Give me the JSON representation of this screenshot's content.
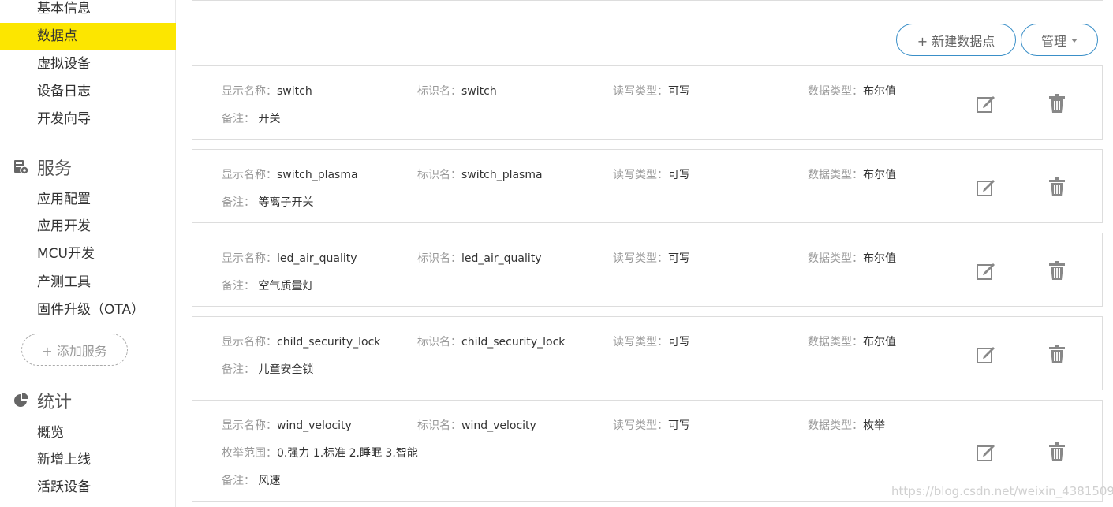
{
  "sidebar": {
    "items_top": [
      "基本信息",
      "数据点",
      "虚拟设备",
      "设备日志",
      "开发向导"
    ],
    "active": "数据点",
    "service_section": "服务",
    "service_items": [
      "应用配置",
      "应用开发",
      "MCU开发",
      "产测工具",
      "固件升级（OTA）"
    ],
    "add_service": "+ 添加服务",
    "stats_section": "统计",
    "stats_items": [
      "概览",
      "新增上线",
      "活跃设备"
    ]
  },
  "toolbar": {
    "new_label": "+ 新建数据点",
    "manage_label": "管理"
  },
  "labels": {
    "display_name": "显示名称：",
    "identifier": "标识名：",
    "rw_type": "读写类型：",
    "data_type": "数据类型：",
    "note": "备注：",
    "enum_range": "枚举范围："
  },
  "datapoints": [
    {
      "display_name": "switch",
      "identifier": "switch",
      "rw_type": "可写",
      "data_type": "布尔值",
      "note": "开关"
    },
    {
      "display_name": "switch_plasma",
      "identifier": "switch_plasma",
      "rw_type": "可写",
      "data_type": "布尔值",
      "note": "等离子开关"
    },
    {
      "display_name": "led_air_quality",
      "identifier": "led_air_quality",
      "rw_type": "可写",
      "data_type": "布尔值",
      "note": "空气质量灯"
    },
    {
      "display_name": "child_security_lock",
      "identifier": "child_security_lock",
      "rw_type": "可写",
      "data_type": "布尔值",
      "note": "儿童安全锁"
    },
    {
      "display_name": "wind_velocity",
      "identifier": "wind_velocity",
      "rw_type": "可写",
      "data_type": "枚举",
      "enum_range": "0.强力 1.标准 2.睡眠 3.智能",
      "note": "风速"
    }
  ],
  "watermark": "https://blog.csdn.net/weixin_43815099",
  "colors": {
    "active_bg": "#fce600",
    "button_border": "#3a8fc8"
  }
}
